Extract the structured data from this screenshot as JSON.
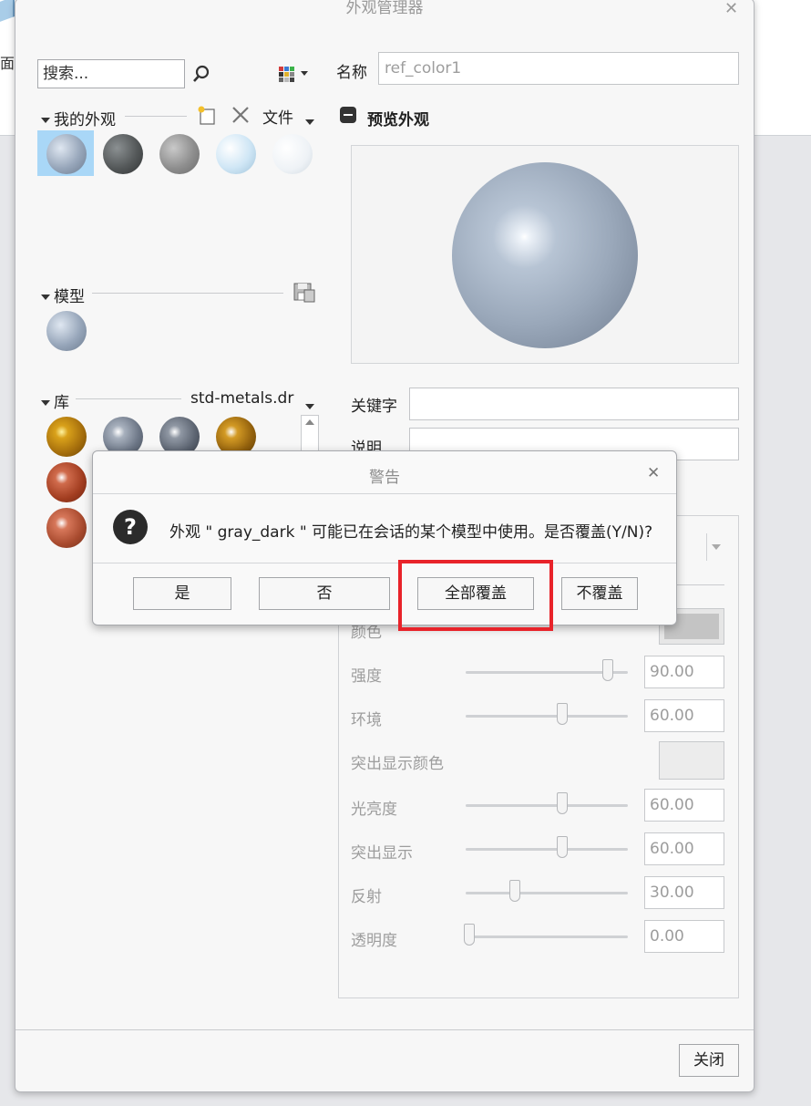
{
  "background": {
    "side_label": "面"
  },
  "window": {
    "title": "外观管理器"
  },
  "search": {
    "placeholder": "搜索..."
  },
  "my_appearances": {
    "label": "我的外观",
    "file_menu": "文件"
  },
  "model": {
    "label": "模型"
  },
  "library": {
    "label": "库",
    "selected": "std-metals.dr"
  },
  "form": {
    "name_label": "名称",
    "name_value": "ref_color1",
    "preview_label": "预览外观",
    "keyword_label": "关键字",
    "description_label": "说明"
  },
  "properties": {
    "color_label": "颜色",
    "intensity_label": "强度",
    "intensity_value": "90.00",
    "intensity": 90,
    "ambient_label": "环境",
    "ambient_value": "60.00",
    "ambient": 60,
    "highlight_color_label": "突出显示颜色",
    "shininess_label": "光亮度",
    "shininess_value": "60.00",
    "shininess": 60,
    "highlight_label": "突出显示",
    "highlight_value": "60.00",
    "highlight": 60,
    "reflection_label": "反射",
    "reflection_value": "30.00",
    "reflection": 30,
    "transparency_label": "透明度",
    "transparency_value": "0.00",
    "transparency": 0
  },
  "footer": {
    "close_button": "关闭"
  },
  "dialog": {
    "title": "警告",
    "message": "外观 \" gray_dark \" 可能已在会话的某个模型中使用。是否覆盖(Y/N)?",
    "yes": "是",
    "no": "否",
    "overwrite_all": "全部覆盖",
    "no_overwrite": "不覆盖"
  },
  "icons": {
    "search": "search-icon",
    "palette": "palette-icon",
    "new": "new-appearance-icon",
    "delete": "delete-icon",
    "save": "save-icon",
    "collapse": "collapse-icon",
    "question": "question-icon",
    "close": "close-icon"
  },
  "colors": {
    "highlight_box": "#e8232a",
    "selection": "#a9d7f7"
  }
}
